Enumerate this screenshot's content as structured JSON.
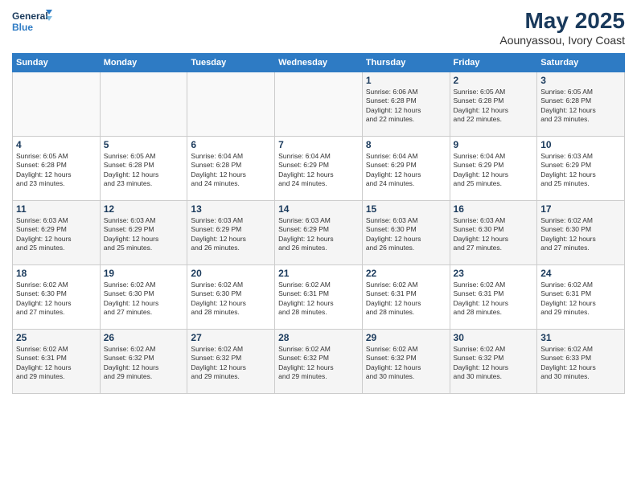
{
  "header": {
    "logo_line1": "General",
    "logo_line2": "Blue",
    "title": "May 2025",
    "subtitle": "Aounyassou, Ivory Coast"
  },
  "calendar": {
    "weekdays": [
      "Sunday",
      "Monday",
      "Tuesday",
      "Wednesday",
      "Thursday",
      "Friday",
      "Saturday"
    ],
    "weeks": [
      [
        {
          "day": "",
          "detail": ""
        },
        {
          "day": "",
          "detail": ""
        },
        {
          "day": "",
          "detail": ""
        },
        {
          "day": "",
          "detail": ""
        },
        {
          "day": "1",
          "detail": "Sunrise: 6:06 AM\nSunset: 6:28 PM\nDaylight: 12 hours\nand 22 minutes."
        },
        {
          "day": "2",
          "detail": "Sunrise: 6:05 AM\nSunset: 6:28 PM\nDaylight: 12 hours\nand 22 minutes."
        },
        {
          "day": "3",
          "detail": "Sunrise: 6:05 AM\nSunset: 6:28 PM\nDaylight: 12 hours\nand 23 minutes."
        }
      ],
      [
        {
          "day": "4",
          "detail": "Sunrise: 6:05 AM\nSunset: 6:28 PM\nDaylight: 12 hours\nand 23 minutes."
        },
        {
          "day": "5",
          "detail": "Sunrise: 6:05 AM\nSunset: 6:28 PM\nDaylight: 12 hours\nand 23 minutes."
        },
        {
          "day": "6",
          "detail": "Sunrise: 6:04 AM\nSunset: 6:28 PM\nDaylight: 12 hours\nand 24 minutes."
        },
        {
          "day": "7",
          "detail": "Sunrise: 6:04 AM\nSunset: 6:29 PM\nDaylight: 12 hours\nand 24 minutes."
        },
        {
          "day": "8",
          "detail": "Sunrise: 6:04 AM\nSunset: 6:29 PM\nDaylight: 12 hours\nand 24 minutes."
        },
        {
          "day": "9",
          "detail": "Sunrise: 6:04 AM\nSunset: 6:29 PM\nDaylight: 12 hours\nand 25 minutes."
        },
        {
          "day": "10",
          "detail": "Sunrise: 6:03 AM\nSunset: 6:29 PM\nDaylight: 12 hours\nand 25 minutes."
        }
      ],
      [
        {
          "day": "11",
          "detail": "Sunrise: 6:03 AM\nSunset: 6:29 PM\nDaylight: 12 hours\nand 25 minutes."
        },
        {
          "day": "12",
          "detail": "Sunrise: 6:03 AM\nSunset: 6:29 PM\nDaylight: 12 hours\nand 25 minutes."
        },
        {
          "day": "13",
          "detail": "Sunrise: 6:03 AM\nSunset: 6:29 PM\nDaylight: 12 hours\nand 26 minutes."
        },
        {
          "day": "14",
          "detail": "Sunrise: 6:03 AM\nSunset: 6:29 PM\nDaylight: 12 hours\nand 26 minutes."
        },
        {
          "day": "15",
          "detail": "Sunrise: 6:03 AM\nSunset: 6:30 PM\nDaylight: 12 hours\nand 26 minutes."
        },
        {
          "day": "16",
          "detail": "Sunrise: 6:03 AM\nSunset: 6:30 PM\nDaylight: 12 hours\nand 27 minutes."
        },
        {
          "day": "17",
          "detail": "Sunrise: 6:02 AM\nSunset: 6:30 PM\nDaylight: 12 hours\nand 27 minutes."
        }
      ],
      [
        {
          "day": "18",
          "detail": "Sunrise: 6:02 AM\nSunset: 6:30 PM\nDaylight: 12 hours\nand 27 minutes."
        },
        {
          "day": "19",
          "detail": "Sunrise: 6:02 AM\nSunset: 6:30 PM\nDaylight: 12 hours\nand 27 minutes."
        },
        {
          "day": "20",
          "detail": "Sunrise: 6:02 AM\nSunset: 6:30 PM\nDaylight: 12 hours\nand 28 minutes."
        },
        {
          "day": "21",
          "detail": "Sunrise: 6:02 AM\nSunset: 6:31 PM\nDaylight: 12 hours\nand 28 minutes."
        },
        {
          "day": "22",
          "detail": "Sunrise: 6:02 AM\nSunset: 6:31 PM\nDaylight: 12 hours\nand 28 minutes."
        },
        {
          "day": "23",
          "detail": "Sunrise: 6:02 AM\nSunset: 6:31 PM\nDaylight: 12 hours\nand 28 minutes."
        },
        {
          "day": "24",
          "detail": "Sunrise: 6:02 AM\nSunset: 6:31 PM\nDaylight: 12 hours\nand 29 minutes."
        }
      ],
      [
        {
          "day": "25",
          "detail": "Sunrise: 6:02 AM\nSunset: 6:31 PM\nDaylight: 12 hours\nand 29 minutes."
        },
        {
          "day": "26",
          "detail": "Sunrise: 6:02 AM\nSunset: 6:32 PM\nDaylight: 12 hours\nand 29 minutes."
        },
        {
          "day": "27",
          "detail": "Sunrise: 6:02 AM\nSunset: 6:32 PM\nDaylight: 12 hours\nand 29 minutes."
        },
        {
          "day": "28",
          "detail": "Sunrise: 6:02 AM\nSunset: 6:32 PM\nDaylight: 12 hours\nand 29 minutes."
        },
        {
          "day": "29",
          "detail": "Sunrise: 6:02 AM\nSunset: 6:32 PM\nDaylight: 12 hours\nand 30 minutes."
        },
        {
          "day": "30",
          "detail": "Sunrise: 6:02 AM\nSunset: 6:32 PM\nDaylight: 12 hours\nand 30 minutes."
        },
        {
          "day": "31",
          "detail": "Sunrise: 6:02 AM\nSunset: 6:33 PM\nDaylight: 12 hours\nand 30 minutes."
        }
      ]
    ]
  }
}
